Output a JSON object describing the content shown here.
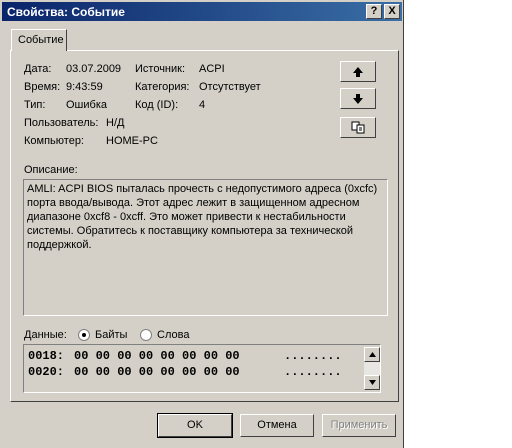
{
  "window": {
    "title": "Свойства: Событие",
    "help_button": "?",
    "close_button": "X"
  },
  "tab": {
    "label": "Событие"
  },
  "fields": {
    "date_label": "Дата:",
    "date_value": "03.07.2009",
    "time_label": "Время:",
    "time_value": "9:43:59",
    "type_label": "Тип:",
    "type_value": "Ошибка",
    "user_label": "Пользователь:",
    "user_value": "Н/Д",
    "computer_label": "Компьютер:",
    "computer_value": "HOME-PC",
    "source_label": "Источник:",
    "source_value": "ACPI",
    "category_label": "Категория:",
    "category_value": "Отсутствует",
    "id_label": "Код (ID):",
    "id_value": "4"
  },
  "side_buttons": {
    "up_icon": "arrow-up-icon",
    "down_icon": "arrow-down-icon",
    "copy_icon": "copy-icon"
  },
  "description": {
    "label": "Описание:",
    "text": "AMLI: ACPI BIOS пыталась прочесть с недопустимого адреса (0xcfc) порта ввода/вывода. Этот адрес лежит в защищенном адресном диапазоне 0xcf8 - 0xcff.  Это может привести к нестабильности системы. Обратитесь к поставщику компьютера за технической поддержкой."
  },
  "data_section": {
    "label": "Данные:",
    "radio_bytes": "Байты",
    "radio_words": "Слова",
    "selected": "bytes",
    "rows": [
      {
        "offset": "0018:",
        "hex": "00 00 00 00 00 00 00 00",
        "ascii": "........"
      },
      {
        "offset": "0020:",
        "hex": "00 00 00 00 00 00 00 00",
        "ascii": "........"
      }
    ]
  },
  "buttons": {
    "ok": "OK",
    "cancel": "Отмена",
    "apply": "Применить"
  }
}
